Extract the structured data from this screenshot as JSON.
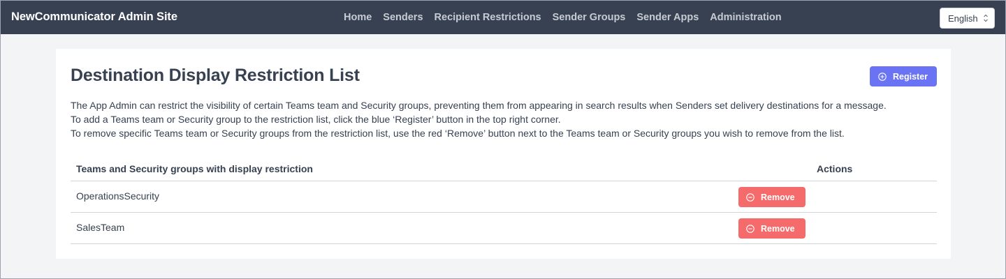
{
  "navbar": {
    "brand": "NewCommunicator Admin Site",
    "links": [
      "Home",
      "Senders",
      "Recipient Restrictions",
      "Sender Groups",
      "Sender Apps",
      "Administration"
    ],
    "language": "English"
  },
  "page": {
    "title": "Destination Display Restriction List",
    "register_label": "Register",
    "description": [
      "The App Admin can restrict the visibility of certain Teams team and Security groups, preventing them from appearing in search results when Senders set delivery destinations for a message.",
      "To add a Teams team or Security group to the restriction list, click the blue ‘Register’ button in the top right corner.",
      "To remove specific Teams team or Security groups from the restriction list, use the red ‘Remove’ button next to the Teams team or Security groups you wish to remove from the list."
    ]
  },
  "table": {
    "headers": [
      "Teams and Security groups with display restriction",
      "Actions"
    ],
    "rows": [
      {
        "name": "OperationsSecurity",
        "action": "Remove"
      },
      {
        "name": "SalesTeam",
        "action": "Remove"
      }
    ]
  },
  "colors": {
    "navbar_bg": "#374151",
    "register_button": "#6b73f5",
    "remove_button": "#f56b6b",
    "page_bg": "#f3f4f6"
  }
}
